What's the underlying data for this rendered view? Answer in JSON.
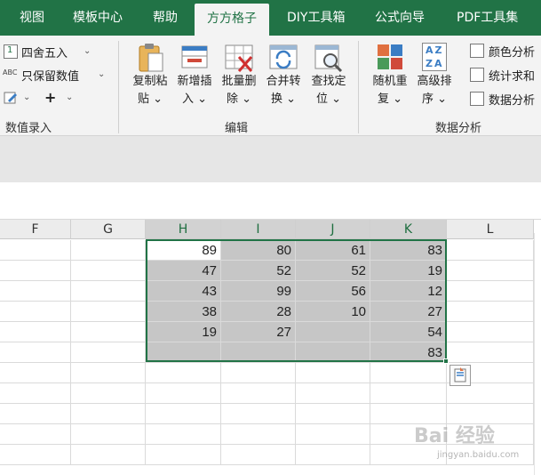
{
  "tabs": [
    {
      "label": "视图",
      "active": false
    },
    {
      "label": "模板中心",
      "active": false
    },
    {
      "label": "帮助",
      "active": false
    },
    {
      "label": "方方格子",
      "active": true
    },
    {
      "label": "DIY工具箱",
      "active": false
    },
    {
      "label": "公式向导",
      "active": false
    },
    {
      "label": "PDF工具集",
      "active": false
    }
  ],
  "ribbon": {
    "numeric_group": {
      "round_label": "四舍五入",
      "round_icon_text": "1",
      "keep_value_label": "只保留数值",
      "abc_icon_text": "ABC",
      "plus_label": "+",
      "group_label": "数值录入"
    },
    "edit_group": {
      "buttons": [
        {
          "line1": "复制粘",
          "line2": "贴"
        },
        {
          "line1": "新增插",
          "line2": "入"
        },
        {
          "line1": "批量删",
          "line2": "除"
        },
        {
          "line1": "合并转",
          "line2": "换"
        },
        {
          "line1": "查找定",
          "line2": "位"
        }
      ],
      "group_label": "编辑"
    },
    "analysis_group": {
      "buttons": [
        {
          "line1": "随机重",
          "line2": "复"
        },
        {
          "line1": "高级排",
          "line2": "序"
        }
      ],
      "az_top": "AZ",
      "az_bottom": "ZA",
      "small_items": [
        "颜色分析",
        "统计求和",
        "数据分析"
      ],
      "group_label": "数据分析"
    }
  },
  "grid": {
    "columns": [
      "F",
      "G",
      "H",
      "I",
      "J",
      "K",
      "L"
    ],
    "selected_columns": [
      "H",
      "I",
      "J",
      "K"
    ],
    "values": {
      "H": [
        "89",
        "47",
        "43",
        "38",
        "19",
        ""
      ],
      "I": [
        "80",
        "52",
        "99",
        "28",
        "27",
        ""
      ],
      "J": [
        "61",
        "52",
        "56",
        "10",
        "",
        ""
      ],
      "K": [
        "83",
        "19",
        "12",
        "27",
        "54",
        "83"
      ]
    }
  },
  "watermark": {
    "text": "Bai 经验",
    "url": "jingyan.baidu.com"
  },
  "colors": {
    "accent": "#217346",
    "selection": "#c6c6c6"
  }
}
